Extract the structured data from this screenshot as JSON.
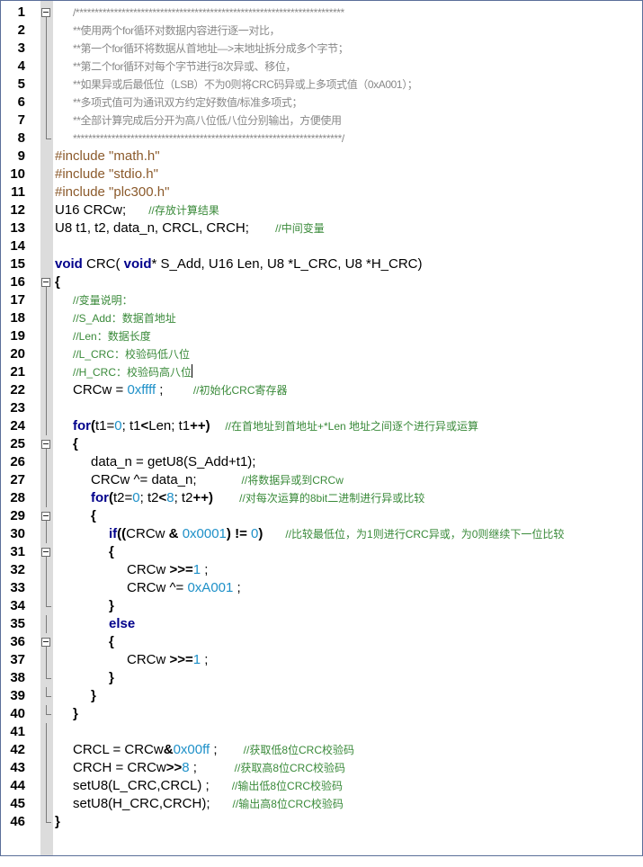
{
  "editor": {
    "lines": [
      {
        "n": "1",
        "fold": "box",
        "ind": 1,
        "t": [
          [
            "st",
            "/**********************************************************************"
          ]
        ]
      },
      {
        "n": "2",
        "fold": "line",
        "ind": 1,
        "t": [
          [
            "st",
            "**使用两个for循环对数据内容进行逐一对比，"
          ]
        ]
      },
      {
        "n": "3",
        "fold": "line",
        "ind": 1,
        "t": [
          [
            "st",
            "**第一个for循环将数据从首地址—>末地址拆分成多个字节；"
          ]
        ]
      },
      {
        "n": "4",
        "fold": "line",
        "ind": 1,
        "t": [
          [
            "st",
            "**第二个for循环对每个字节进行8次异或、移位，"
          ]
        ]
      },
      {
        "n": "5",
        "fold": "line",
        "ind": 1,
        "t": [
          [
            "st",
            "**如果异或后最低位（LSB）不为0则将CRC码异或上多项式值（0xA001）；"
          ]
        ]
      },
      {
        "n": "6",
        "fold": "line",
        "ind": 1,
        "t": [
          [
            "st",
            "**多项式值可为通讯双方约定好数值/标准多项式；"
          ]
        ]
      },
      {
        "n": "7",
        "fold": "line",
        "ind": 1,
        "t": [
          [
            "st",
            "**全部计算完成后分开为高八位低八位分别输出，方便使用"
          ]
        ]
      },
      {
        "n": "8",
        "fold": "end",
        "ind": 1,
        "t": [
          [
            "st",
            "**********************************************************************/"
          ]
        ]
      },
      {
        "n": "9",
        "fold": "",
        "ind": 0,
        "t": [
          [
            "pp",
            "#include \"math.h\""
          ]
        ]
      },
      {
        "n": "10",
        "fold": "",
        "ind": 0,
        "t": [
          [
            "pp",
            "#include \"stdio.h\""
          ]
        ]
      },
      {
        "n": "11",
        "fold": "",
        "ind": 0,
        "t": [
          [
            "pp",
            "#include \"plc300.h\""
          ]
        ]
      },
      {
        "n": "12",
        "fold": "",
        "ind": 0,
        "t": [
          [
            "",
            "U16 CRCw;      "
          ],
          [
            "cm",
            "//存放计算结果"
          ]
        ]
      },
      {
        "n": "13",
        "fold": "",
        "ind": 0,
        "t": [
          [
            "",
            "U8 t1, t2, data_n, CRCL, CRCH;       "
          ],
          [
            "cm",
            "//中间变量"
          ]
        ]
      },
      {
        "n": "14",
        "fold": "",
        "ind": 0,
        "t": []
      },
      {
        "n": "15",
        "fold": "",
        "ind": 0,
        "t": [
          [
            "kw",
            "void"
          ],
          [
            "",
            " CRC( "
          ],
          [
            "kw",
            "void"
          ],
          [
            "",
            "* S_Add, U16 Len, U8 *L_CRC, U8 *H_CRC)"
          ]
        ]
      },
      {
        "n": "16",
        "fold": "box",
        "ind": 0,
        "t": [
          [
            "op",
            "{"
          ]
        ]
      },
      {
        "n": "17",
        "fold": "line",
        "ind": 1,
        "t": [
          [
            "cm",
            "//变量说明："
          ]
        ]
      },
      {
        "n": "18",
        "fold": "line",
        "ind": 1,
        "t": [
          [
            "cm",
            "//S_Add：数据首地址"
          ]
        ]
      },
      {
        "n": "19",
        "fold": "line",
        "ind": 1,
        "t": [
          [
            "cm",
            "//Len：数据长度"
          ]
        ]
      },
      {
        "n": "20",
        "fold": "line",
        "ind": 1,
        "t": [
          [
            "cm",
            "//L_CRC：校验码低八位"
          ]
        ]
      },
      {
        "n": "21",
        "fold": "line",
        "ind": 1,
        "t": [
          [
            "cm",
            "//H_CRC：校验码高八位"
          ],
          [
            "caret",
            ""
          ]
        ]
      },
      {
        "n": "22",
        "fold": "line",
        "ind": 1,
        "t": [
          [
            "",
            "CRCw = "
          ],
          [
            "nm",
            "0xffff"
          ],
          [
            "",
            " ;        "
          ],
          [
            "cm",
            "//初始化CRC寄存器"
          ]
        ]
      },
      {
        "n": "23",
        "fold": "line",
        "ind": 0,
        "t": []
      },
      {
        "n": "24",
        "fold": "line",
        "ind": 1,
        "t": [
          [
            "kw",
            "for"
          ],
          [
            "op",
            "("
          ],
          [
            "",
            "t1="
          ],
          [
            "nm",
            "0"
          ],
          [
            "",
            "; t1"
          ],
          [
            "op",
            "<"
          ],
          [
            "",
            "Len; t1"
          ],
          [
            "op",
            "++"
          ],
          [
            "op",
            ")"
          ],
          [
            "",
            "    "
          ],
          [
            "cm",
            "//在首地址到首地址+*Len 地址之间逐个进行异或运算"
          ]
        ]
      },
      {
        "n": "25",
        "fold": "box",
        "ind": 1,
        "t": [
          [
            "op",
            "{"
          ]
        ]
      },
      {
        "n": "26",
        "fold": "line",
        "ind": 2,
        "t": [
          [
            "",
            "data_n = getU8(S_Add+t1);"
          ]
        ]
      },
      {
        "n": "27",
        "fold": "line",
        "ind": 2,
        "t": [
          [
            "",
            "CRCw ^= data_n;            "
          ],
          [
            "cm",
            "//将数据异或到CRCw"
          ]
        ]
      },
      {
        "n": "28",
        "fold": "line",
        "ind": 2,
        "t": [
          [
            "kw",
            "for"
          ],
          [
            "op",
            "("
          ],
          [
            "",
            "t2="
          ],
          [
            "nm",
            "0"
          ],
          [
            "",
            "; t2"
          ],
          [
            "op",
            "<"
          ],
          [
            "nm",
            "8"
          ],
          [
            "",
            "; t2"
          ],
          [
            "op",
            "++"
          ],
          [
            "op",
            ")"
          ],
          [
            "",
            "       "
          ],
          [
            "cm",
            "//对每次运算的8bit二进制进行异或比较"
          ]
        ]
      },
      {
        "n": "29",
        "fold": "box",
        "ind": 2,
        "t": [
          [
            "op",
            "{"
          ]
        ]
      },
      {
        "n": "30",
        "fold": "line",
        "ind": 3,
        "t": [
          [
            "kw",
            "if"
          ],
          [
            "op",
            "(("
          ],
          [
            "",
            "CRCw "
          ],
          [
            "op",
            "&"
          ],
          [
            "",
            " "
          ],
          [
            "nm",
            "0x0001"
          ],
          [
            "op",
            ")"
          ],
          [
            "",
            " "
          ],
          [
            "op",
            "!="
          ],
          [
            "",
            " "
          ],
          [
            "nm",
            "0"
          ],
          [
            "op",
            ")"
          ],
          [
            "",
            "      "
          ],
          [
            "cm",
            "//比较最低位，为1则进行CRC异或，为0则继续下一位比较"
          ]
        ]
      },
      {
        "n": "31",
        "fold": "box",
        "ind": 3,
        "t": [
          [
            "op",
            "{"
          ]
        ]
      },
      {
        "n": "32",
        "fold": "line",
        "ind": 4,
        "t": [
          [
            "",
            "CRCw "
          ],
          [
            "op",
            ">>="
          ],
          [
            "nm",
            "1"
          ],
          [
            "",
            " ;"
          ]
        ]
      },
      {
        "n": "33",
        "fold": "line",
        "ind": 4,
        "t": [
          [
            "",
            "CRCw ^= "
          ],
          [
            "nm",
            "0xA001"
          ],
          [
            "",
            " ;"
          ]
        ]
      },
      {
        "n": "34",
        "fold": "end",
        "ind": 3,
        "t": [
          [
            "op",
            "}"
          ]
        ]
      },
      {
        "n": "35",
        "fold": "line",
        "ind": 3,
        "t": [
          [
            "kw",
            "else"
          ]
        ]
      },
      {
        "n": "36",
        "fold": "box",
        "ind": 3,
        "t": [
          [
            "op",
            "{"
          ]
        ]
      },
      {
        "n": "37",
        "fold": "line",
        "ind": 4,
        "t": [
          [
            "",
            "CRCw "
          ],
          [
            "op",
            ">>="
          ],
          [
            "nm",
            "1"
          ],
          [
            "",
            " ;"
          ]
        ]
      },
      {
        "n": "38",
        "fold": "end",
        "ind": 3,
        "t": [
          [
            "op",
            "}"
          ]
        ]
      },
      {
        "n": "39",
        "fold": "end",
        "ind": 2,
        "t": [
          [
            "op",
            "}"
          ]
        ]
      },
      {
        "n": "40",
        "fold": "end",
        "ind": 1,
        "t": [
          [
            "op",
            "}"
          ]
        ]
      },
      {
        "n": "41",
        "fold": "line",
        "ind": 0,
        "t": []
      },
      {
        "n": "42",
        "fold": "line",
        "ind": 1,
        "t": [
          [
            "",
            "CRCL = CRCw"
          ],
          [
            "op",
            "&"
          ],
          [
            "nm",
            "0x00ff"
          ],
          [
            "",
            " ;       "
          ],
          [
            "cm",
            "//获取低8位CRC校验码"
          ]
        ]
      },
      {
        "n": "43",
        "fold": "line",
        "ind": 1,
        "t": [
          [
            "",
            "CRCH = CRCw"
          ],
          [
            "op",
            ">>"
          ],
          [
            "nm",
            "8"
          ],
          [
            "",
            " ;          "
          ],
          [
            "cm",
            "//获取高8位CRC校验码"
          ]
        ]
      },
      {
        "n": "44",
        "fold": "line",
        "ind": 1,
        "t": [
          [
            "",
            "setU8(L_CRC,CRCL) ;      "
          ],
          [
            "cm",
            "//输出低8位CRC校验码"
          ]
        ]
      },
      {
        "n": "45",
        "fold": "line",
        "ind": 1,
        "t": [
          [
            "",
            "setU8(H_CRC,CRCH);      "
          ],
          [
            "cm",
            "//输出高8位CRC校验码"
          ]
        ]
      },
      {
        "n": "46",
        "fold": "end",
        "ind": 0,
        "t": [
          [
            "op",
            "}"
          ]
        ]
      }
    ]
  }
}
